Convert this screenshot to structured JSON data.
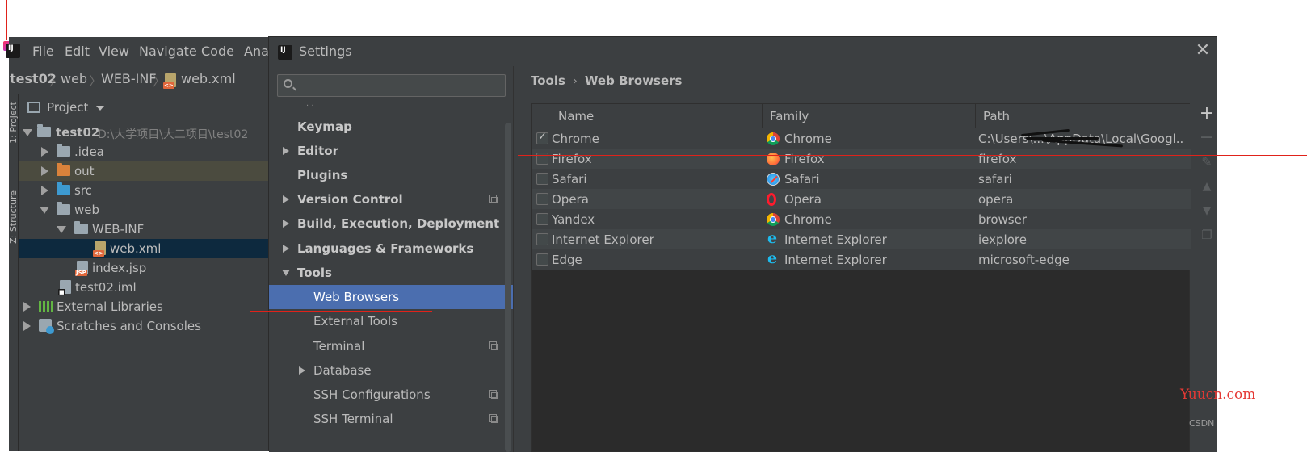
{
  "ide": {
    "menu": [
      "File",
      "Edit",
      "View",
      "Navigate",
      "Code",
      "Anal"
    ],
    "breadcrumb": [
      "test02",
      "web",
      "WEB-INF",
      "web.xml"
    ],
    "side_tabs": [
      "1: Project",
      "Z: Structure"
    ],
    "project_header": "Project",
    "tree": [
      {
        "label": "test02",
        "sub": "D:\\大学项目\\大二项目\\test02"
      },
      {
        "label": ".idea"
      },
      {
        "label": "out"
      },
      {
        "label": "src"
      },
      {
        "label": "web"
      },
      {
        "label": "WEB-INF"
      },
      {
        "label": "web.xml"
      },
      {
        "label": "index.jsp"
      },
      {
        "label": "test02.iml"
      },
      {
        "label": "External Libraries"
      },
      {
        "label": "Scratches and Consoles"
      }
    ]
  },
  "dialog": {
    "title": "Settings",
    "search_placeholder": "",
    "nav": [
      {
        "label": "Keymap"
      },
      {
        "label": "Editor"
      },
      {
        "label": "Plugins"
      },
      {
        "label": "Version Control"
      },
      {
        "label": "Build, Execution, Deployment"
      },
      {
        "label": "Languages & Frameworks"
      },
      {
        "label": "Tools"
      },
      {
        "label": "Web Browsers"
      },
      {
        "label": "External Tools"
      },
      {
        "label": "Terminal"
      },
      {
        "label": "Database"
      },
      {
        "label": "SSH Configurations"
      },
      {
        "label": "SSH Terminal"
      }
    ],
    "content_breadcrumb": {
      "parent": "Tools",
      "sep": "›",
      "current": "Web Browsers"
    },
    "table": {
      "columns": [
        "Name",
        "Family",
        "Path"
      ],
      "rows": [
        {
          "checked": true,
          "name": "Chrome",
          "family": "Chrome",
          "icon": "chrome-icon",
          "path": "C:\\Users\\...\\AppData\\Local\\Googl..."
        },
        {
          "checked": false,
          "name": "Firefox",
          "family": "Firefox",
          "icon": "firefox-icon",
          "path": "firefox"
        },
        {
          "checked": false,
          "name": "Safari",
          "family": "Safari",
          "icon": "safari-icon",
          "path": "safari"
        },
        {
          "checked": false,
          "name": "Opera",
          "family": "Opera",
          "icon": "opera-icon",
          "path": "opera"
        },
        {
          "checked": false,
          "name": "Yandex",
          "family": "Chrome",
          "icon": "chrome-icon",
          "path": "browser"
        },
        {
          "checked": false,
          "name": "Internet Explorer",
          "family": "Internet Explorer",
          "icon": "ie-icon",
          "path": "iexplore"
        },
        {
          "checked": false,
          "name": "Edge",
          "family": "Internet Explorer",
          "icon": "ie-icon",
          "path": "microsoft-edge"
        }
      ]
    },
    "tools": [
      "add-icon",
      "remove-icon",
      "edit-icon",
      "move-up-icon",
      "move-down-icon",
      "copy-icon"
    ]
  },
  "watermark": "Yuucn.com",
  "csdn_label": "CSDN",
  "colors": {
    "accent": "#4b6eaf",
    "annotation": "#e0221a",
    "dark_bg": "#3c3f41"
  }
}
